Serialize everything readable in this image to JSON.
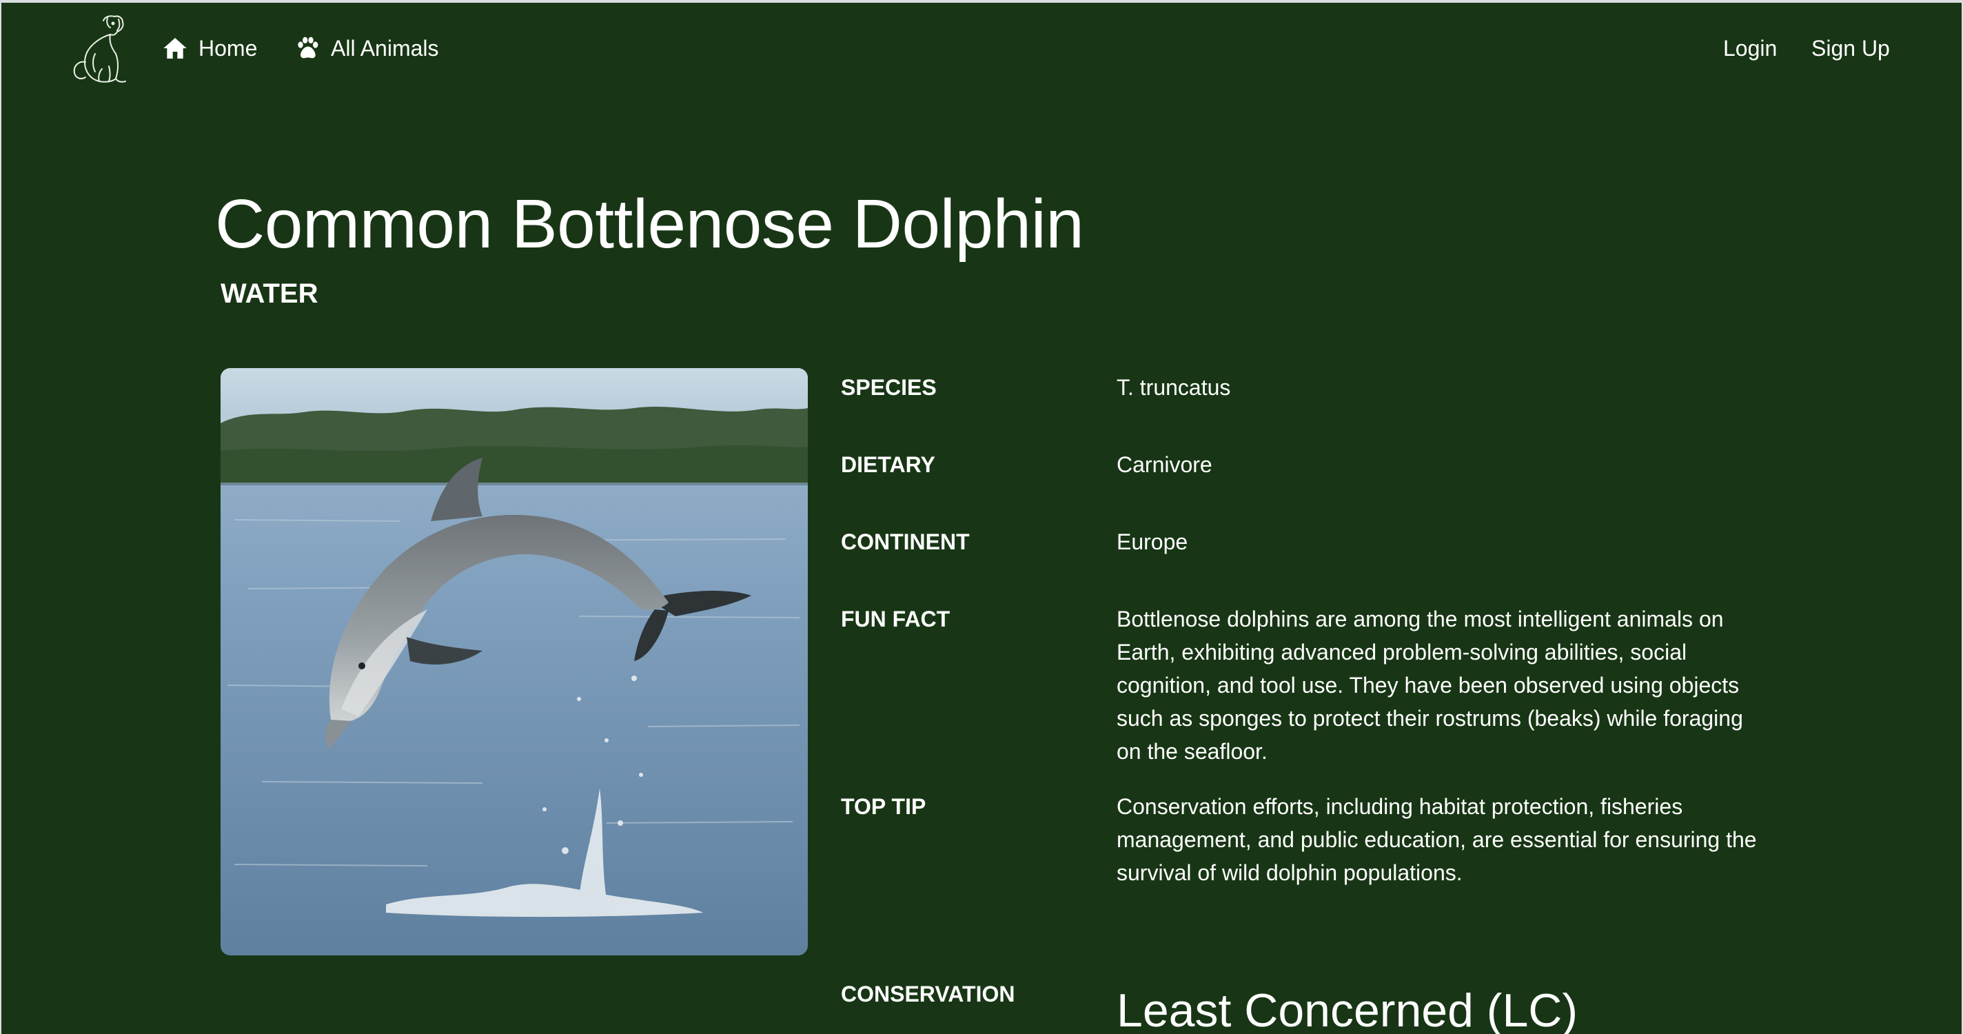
{
  "nav": {
    "home_label": "Home",
    "home_icon": "home-icon",
    "animals_label": "All Animals",
    "animals_icon": "paw-icon",
    "login_label": "Login",
    "signup_label": "Sign Up",
    "logo_icon": "dog-logo-icon"
  },
  "animal": {
    "name": "Common Bottlenose Dolphin",
    "habitat": "WATER",
    "photo_alt": "Bottlenose dolphin leaping out of the water"
  },
  "facts": {
    "species_label": "SPECIES",
    "species_value": "T. truncatus",
    "dietary_label": "DIETARY",
    "dietary_value": "Carnivore",
    "continent_label": "CONTINENT",
    "continent_value": "Europe",
    "fun_fact_label": "FUN FACT",
    "fun_fact_value": "Bottlenose dolphins are among the most intelligent animals on Earth, exhibiting advanced problem-solving abilities, social cognition, and tool use. They have been observed using objects such as sponges to protect their rostrums (beaks) while foraging on the seafloor.",
    "top_tip_label": "TOP TIP",
    "top_tip_value": "Conservation efforts, including habitat protection, fisheries management, and public education, are essential for ensuring the survival of wild dolphin populations.",
    "conservation_label": "CONSERVATION",
    "conservation_value": "Least Concerned (LC)"
  },
  "colors": {
    "background": "#183615",
    "text": "#ffffff"
  }
}
